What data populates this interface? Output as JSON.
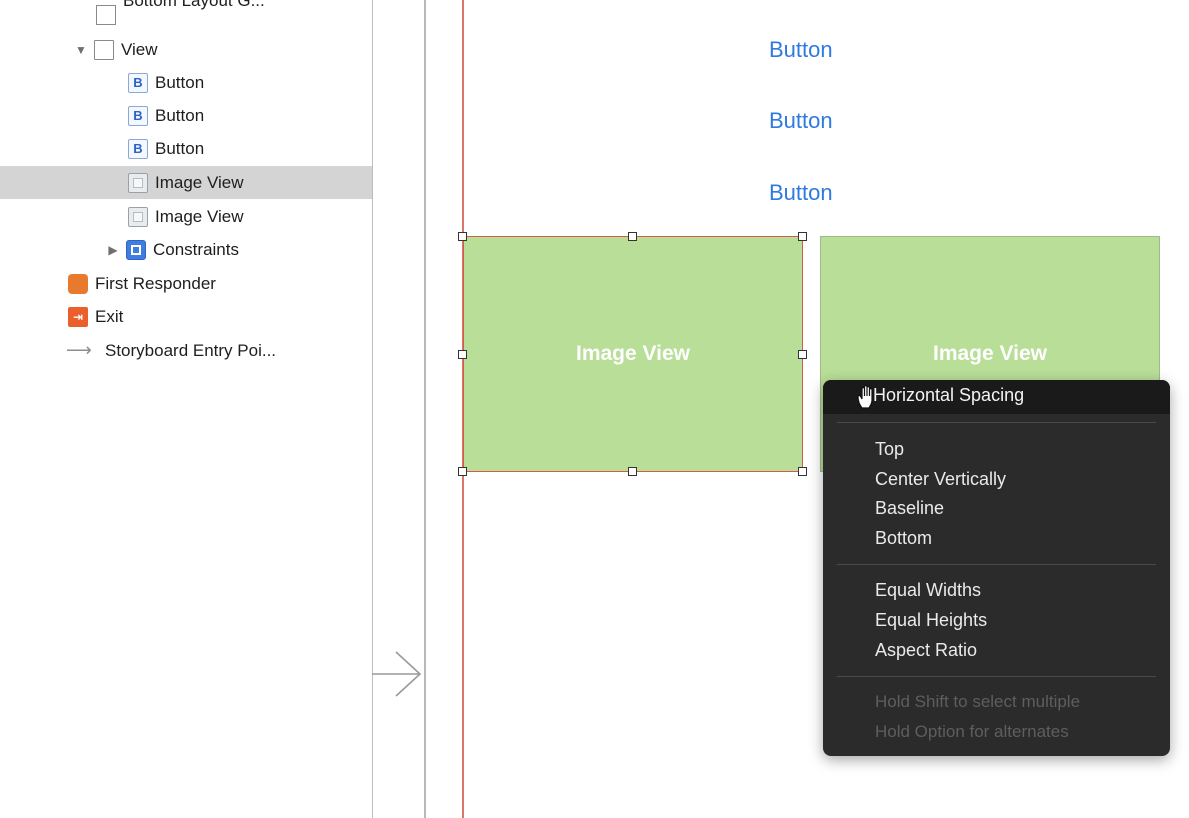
{
  "outline": {
    "items": [
      {
        "label": "Bottom Layout G...",
        "icon": "layout-guide-icon"
      },
      {
        "label": "View",
        "icon": "view-icon",
        "disclosure": "▼"
      },
      {
        "label": "Button",
        "icon": "button-icon",
        "badge": "B"
      },
      {
        "label": "Button",
        "icon": "button-icon",
        "badge": "B"
      },
      {
        "label": "Button",
        "icon": "button-icon",
        "badge": "B"
      },
      {
        "label": "Image View",
        "icon": "image-view-icon",
        "selected": true
      },
      {
        "label": "Image View",
        "icon": "image-view-icon"
      },
      {
        "label": "Constraints",
        "icon": "constraints-icon",
        "disclosure": "▶"
      },
      {
        "label": "First Responder",
        "icon": "first-responder-icon"
      },
      {
        "label": "Exit",
        "icon": "exit-icon"
      },
      {
        "label": "Storyboard Entry Poi...",
        "icon": "entry-point-arrow-icon"
      }
    ]
  },
  "canvas": {
    "buttons": [
      "Button",
      "Button",
      "Button"
    ],
    "image_views": [
      "Image View",
      "Image View"
    ],
    "colors": {
      "image_view_fill": "#b8de98",
      "button_text": "#2f7ae0",
      "selection_border": "#d45b4a"
    }
  },
  "menu": {
    "title": "Horizontal Spacing",
    "group1": [
      "Top",
      "Center Vertically",
      "Baseline",
      "Bottom"
    ],
    "group2": [
      "Equal Widths",
      "Equal Heights",
      "Aspect Ratio"
    ],
    "hints": [
      "Hold Shift to select multiple",
      "Hold Option for alternates"
    ]
  }
}
